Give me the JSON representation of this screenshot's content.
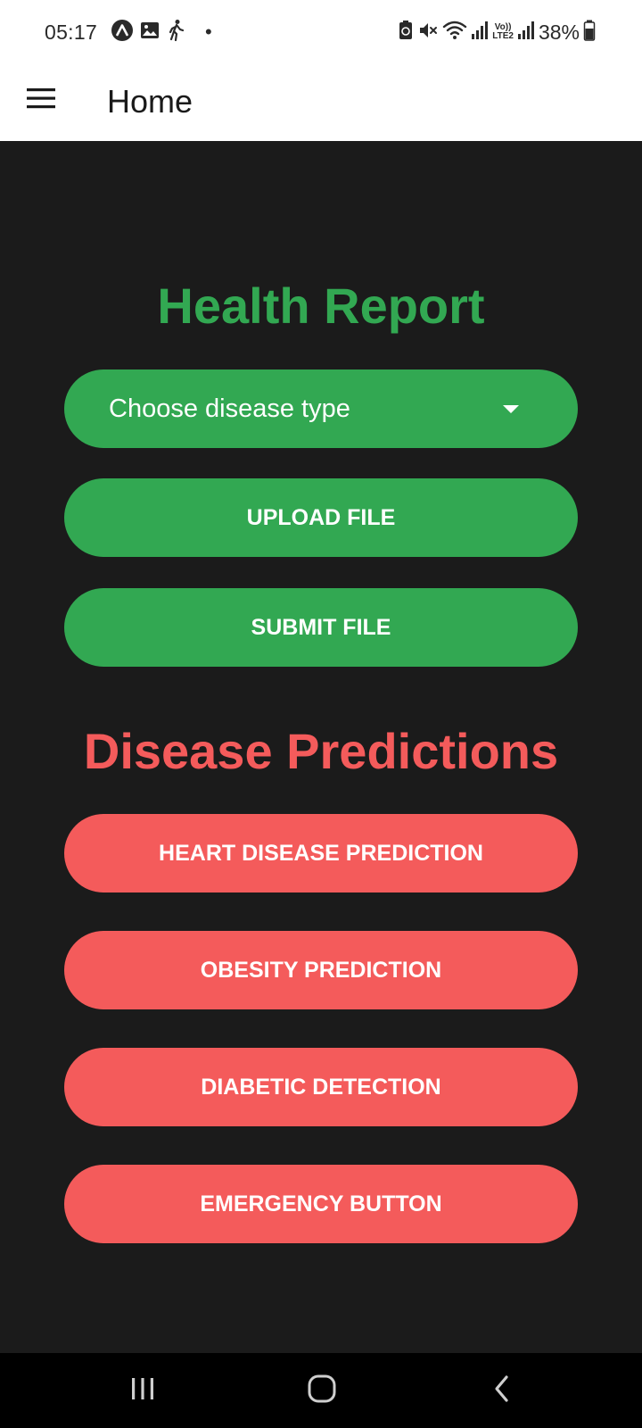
{
  "status_bar": {
    "time": "05:17",
    "dot": "•",
    "battery_percent": "38%",
    "left_icons": [
      "app-notification-icon",
      "gallery-icon",
      "walking-icon"
    ],
    "right_icons": [
      "battery-saver-icon",
      "mute-icon",
      "wifi-icon",
      "signal-icon",
      "volte-lte2-icon",
      "signal-icon",
      "battery-icon"
    ],
    "volte_label": "Vo))",
    "lte_label": "LTE2"
  },
  "app_bar": {
    "title": "Home",
    "menu_icon": "hamburger-menu-icon"
  },
  "health_report": {
    "title": "Health Report",
    "disease_select": {
      "selected": "Choose disease type"
    },
    "upload_label": "UPLOAD FILE",
    "submit_label": "SUBMIT FILE"
  },
  "disease_predictions": {
    "title": "Disease Predictions",
    "buttons": [
      {
        "label": "HEART DISEASE PREDICTION"
      },
      {
        "label": "OBESITY PREDICTION"
      },
      {
        "label": "DIABETIC DETECTION"
      },
      {
        "label": "EMERGENCY BUTTON"
      }
    ]
  },
  "nav_bar": {
    "icons": [
      "recent-apps-icon",
      "home-icon",
      "back-icon"
    ]
  },
  "colors": {
    "background": "#1b1b1b",
    "green_accent": "#32a852",
    "red_accent": "#f45b5b",
    "bar_background": "#ffffff",
    "nav_background": "#000000"
  }
}
